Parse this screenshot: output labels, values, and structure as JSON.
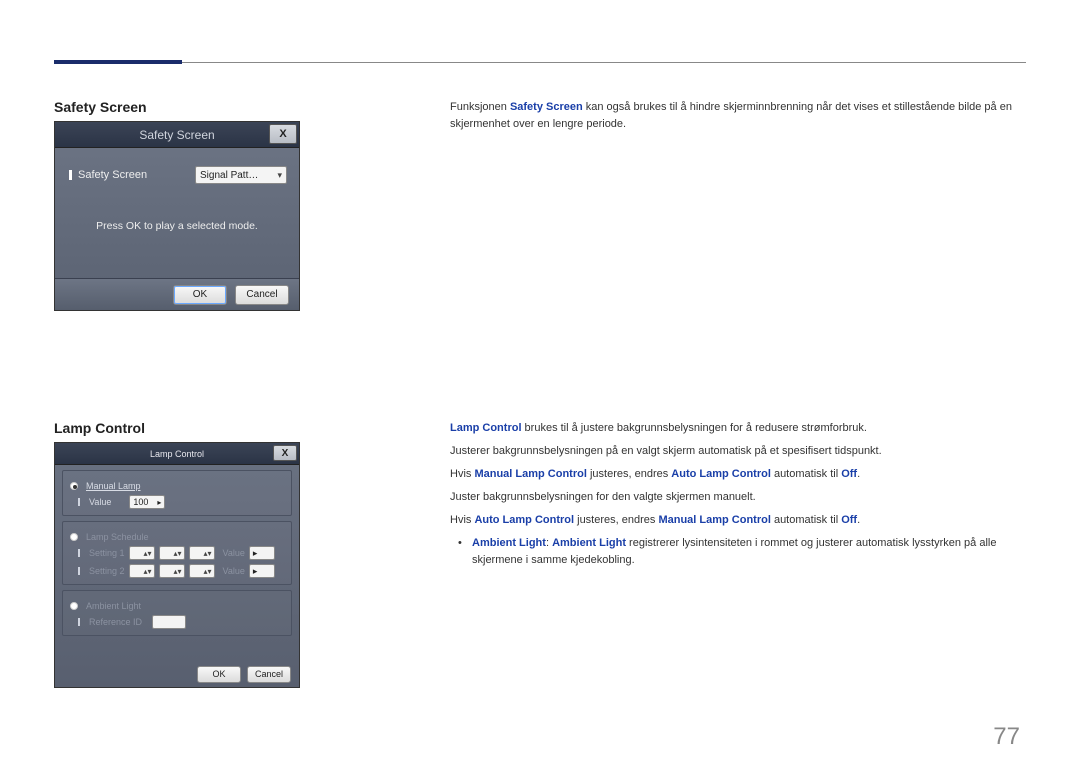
{
  "page_number": "77",
  "section1": {
    "title": "Safety Screen",
    "body_prefix": "Funksjonen ",
    "body_emph": "Safety Screen",
    "body_suffix": " kan også brukes til å hindre skjerminnbrenning når det vises et stillestående bilde på en skjermenhet over en lengre periode.",
    "dialog": {
      "title": "Safety Screen",
      "close": "X",
      "field_label": "Safety Screen",
      "field_value": "Signal Patt…",
      "message": "Press OK to play a selected mode.",
      "ok": "OK",
      "cancel": "Cancel"
    }
  },
  "section2": {
    "title": "Lamp Control",
    "p1_emph": "Lamp Control",
    "p1_rest": " brukes til å justere bakgrunnsbelysningen for å redusere strømforbruk.",
    "p2": "Justerer bakgrunnsbelysningen på en valgt skjerm automatisk på et spesifisert tidspunkt.",
    "p3_a": "Hvis ",
    "p3_b": "Manual Lamp Control",
    "p3_c": " justeres, endres ",
    "p3_d": "Auto Lamp Control",
    "p3_e": " automatisk til ",
    "p3_f": "Off",
    "p3_g": ".",
    "p4": "Juster bakgrunnsbelysningen for den valgte skjermen manuelt.",
    "p5_a": "Hvis ",
    "p5_b": "Auto Lamp Control",
    "p5_c": " justeres, endres ",
    "p5_d": "Manual Lamp Control",
    "p5_e": " automatisk til ",
    "p5_f": "Off",
    "p5_g": ".",
    "bullet_a": "Ambient Light",
    "bullet_b": ": ",
    "bullet_c": "Ambient Light",
    "bullet_d": " registrerer lysintensiteten i rommet og justerer automatisk lysstyrken på alle skjermene i samme kjedekobling.",
    "dialog": {
      "title": "Lamp Control",
      "close": "X",
      "manual_lamp": "Manual Lamp",
      "value_label": "Value",
      "value_num": "100",
      "lamp_schedule": "Lamp Schedule",
      "setting1": "Setting 1",
      "setting2": "Setting 2",
      "value_dim": "Value",
      "ambient_light": "Ambient Light",
      "reference_id": "Reference ID",
      "ok": "OK",
      "cancel": "Cancel"
    }
  }
}
